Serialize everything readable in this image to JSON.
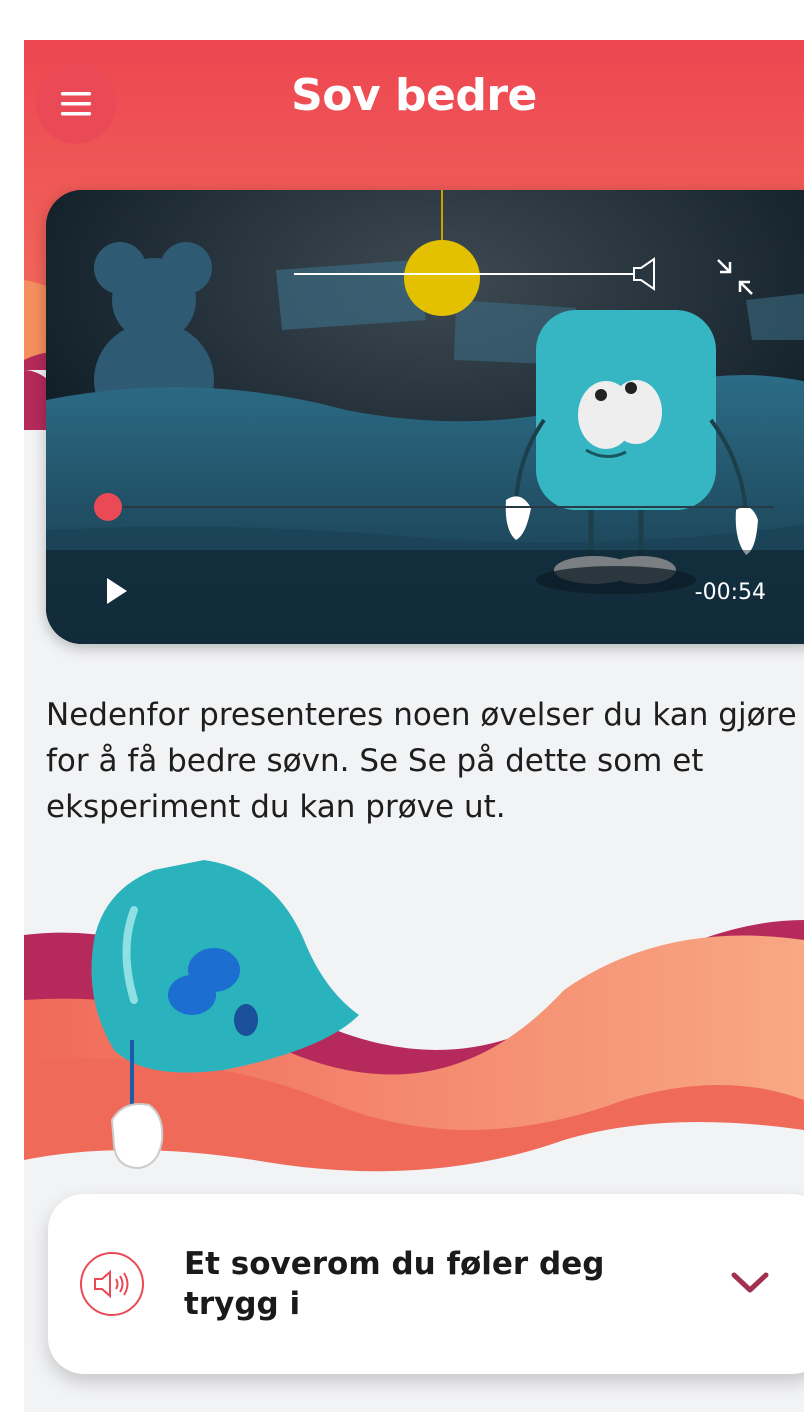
{
  "app": {
    "title": "Sov bedre",
    "accent_color": "#ea4a55",
    "menu_icon": "hamburger-menu-icon"
  },
  "video": {
    "time_remaining": "-00:54",
    "progress": 0.0,
    "volume": 1.0,
    "icons": [
      "speaker-icon",
      "collapse-icon",
      "play-icon"
    ]
  },
  "intro_text": "Nedenfor presenteres noen øvelser du kan gjøre for å få bedre søvn. Se Se på dette som et eksperiment du kan prøve ut.",
  "exercise_card": {
    "title": "Et soverom du føler deg trygg i",
    "icon": "audio-speaker-icon",
    "expand_icon": "chevron-down-icon",
    "chevron_color": "#a3304f"
  }
}
